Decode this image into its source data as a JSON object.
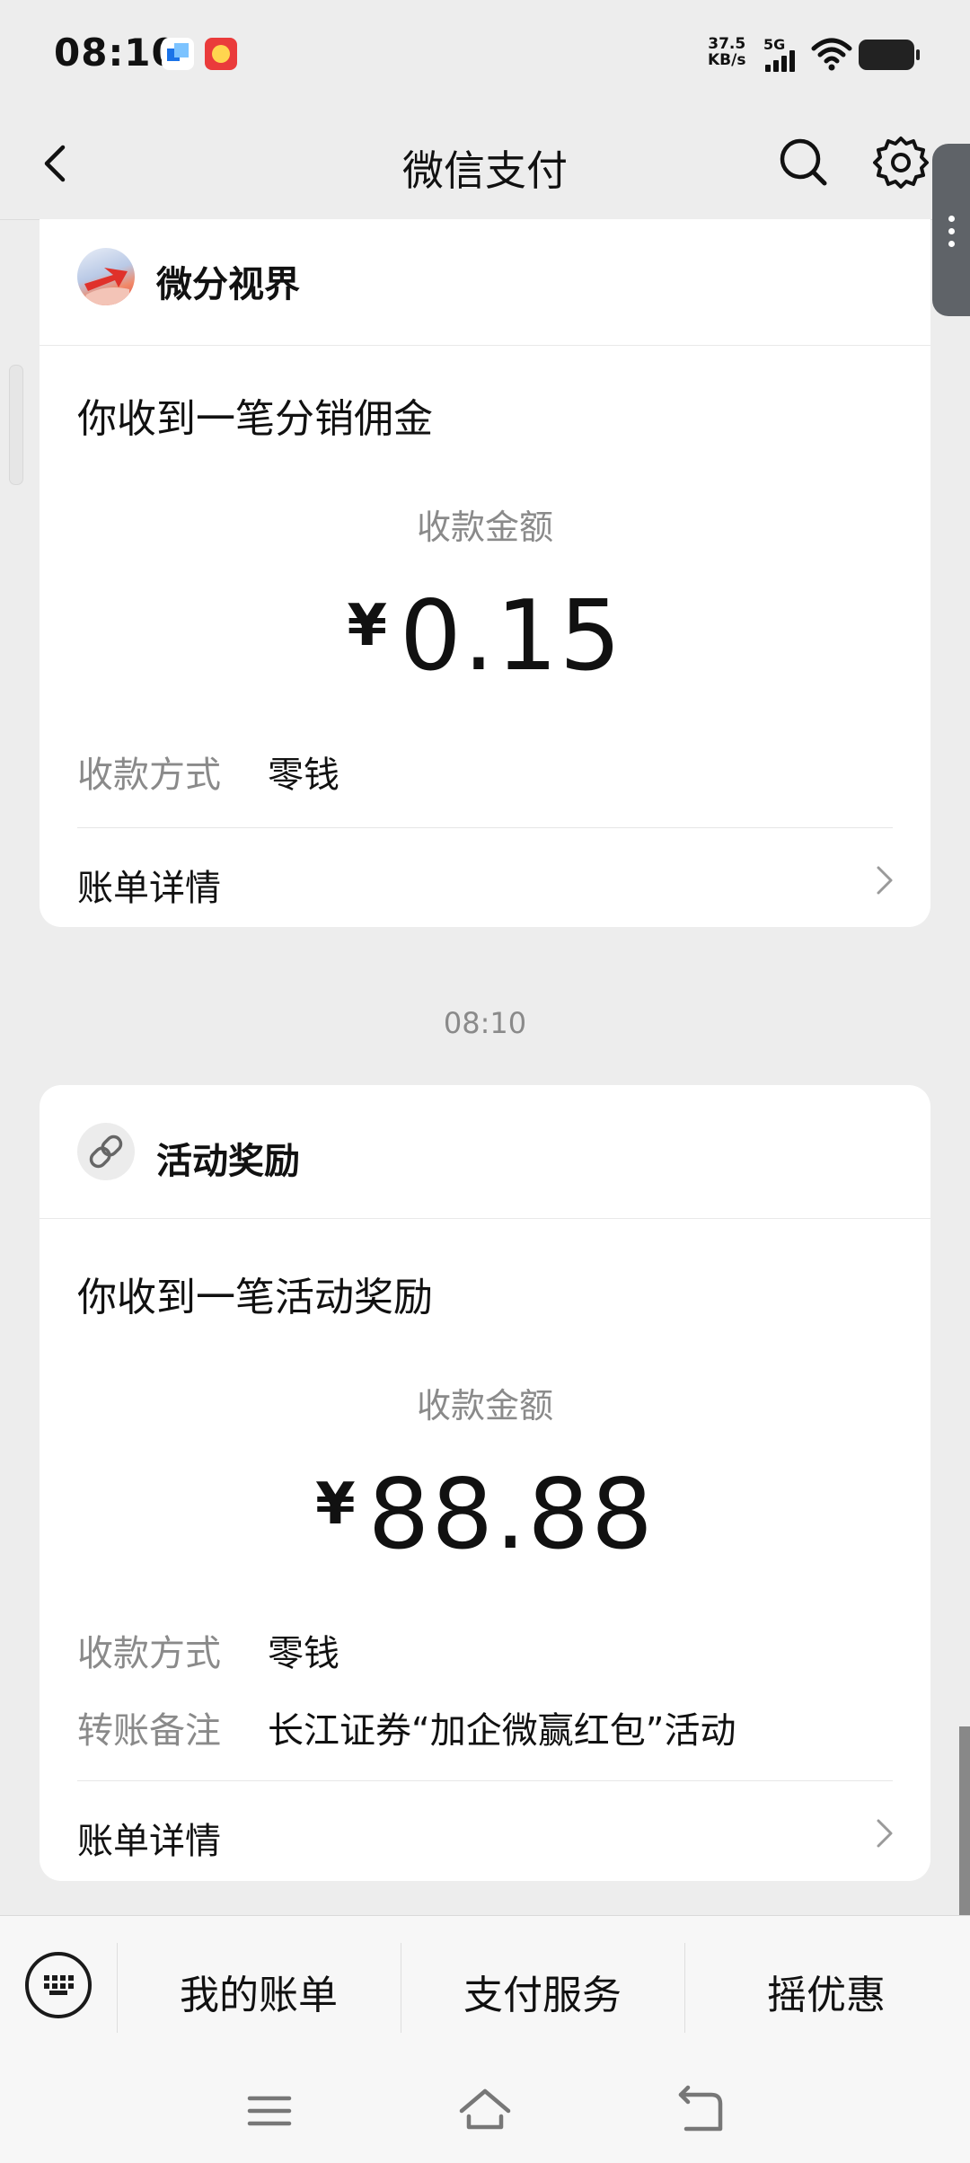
{
  "status_bar": {
    "time": "08:10",
    "net_speed_value": "37.5",
    "net_speed_unit": "KB/s",
    "network": "5G"
  },
  "nav": {
    "title": "微信支付"
  },
  "messages": [
    {
      "merchant": "微分视界",
      "title": "你收到一笔分销佣金",
      "amount_label": "收款金额",
      "currency": "¥",
      "amount": "0.15",
      "method_label": "收款方式",
      "method_value": "零钱",
      "detail_label": "账单详情"
    },
    {
      "merchant": "活动奖励",
      "title": "你收到一笔活动奖励",
      "amount_label": "收款金额",
      "currency": "¥",
      "amount": "88.88",
      "method_label": "收款方式",
      "method_value": "零钱",
      "remark_label": "转账备注",
      "remark_value": "长江证券“加企微赢红包”活动",
      "detail_label": "账单详情"
    }
  ],
  "timestamp": "08:10",
  "bottom_menu": {
    "items": [
      "我的账单",
      "支付服务",
      "摇优惠"
    ]
  }
}
